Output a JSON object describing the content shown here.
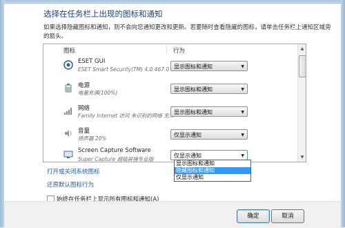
{
  "dialog": {
    "heading": "选择在任务栏上出现的图标和通知",
    "description": "如果选择隐藏图标和通知，则不会向您通知更改和更新。若要随时查看隐藏的图标，请单击任务栏上通知区域旁的箭头。"
  },
  "table": {
    "col_icons": "图标",
    "col_behavior": "行为",
    "rows": [
      {
        "title": "ESET GUI",
        "subtitle": "ESET Smart Security(TM) 4.0.467.0 ...",
        "behavior": "显示图标和通知",
        "icon": "eset-icon"
      },
      {
        "title": "电源",
        "subtitle": "电量充满(100%)",
        "behavior": "显示图标和通知",
        "icon": "battery-icon"
      },
      {
        "title": "网络",
        "subtitle": "Family Internet 访问 未识别的网络 无...",
        "behavior": "显示图标和通知",
        "icon": "network-icon"
      },
      {
        "title": "音量",
        "subtitle": "扬声器 20%",
        "behavior": "仅显示通知",
        "icon": "speaker-icon"
      },
      {
        "title": "Screen Capture Software",
        "subtitle": "Super Capture 超级屏捕专业版",
        "behavior": "仅显示通知",
        "icon": "screen-capture-icon"
      }
    ]
  },
  "dropdown": {
    "options": [
      "显示图标和通知",
      "隐藏图标和通知",
      "仅显示通知"
    ],
    "highlighted_index": 1
  },
  "links": {
    "system_icons": "打开或关闭系统图标",
    "restore_defaults": "还原默认图标行为"
  },
  "checkbox": {
    "label": "始终在任务栏上显示所有图标和通知(A)",
    "checked": false
  },
  "buttons": {
    "ok": "确定",
    "cancel": "取消"
  },
  "colors": {
    "heading": "#1e3f8a",
    "link": "#1f5fb0",
    "highlight": "#3399ff"
  }
}
